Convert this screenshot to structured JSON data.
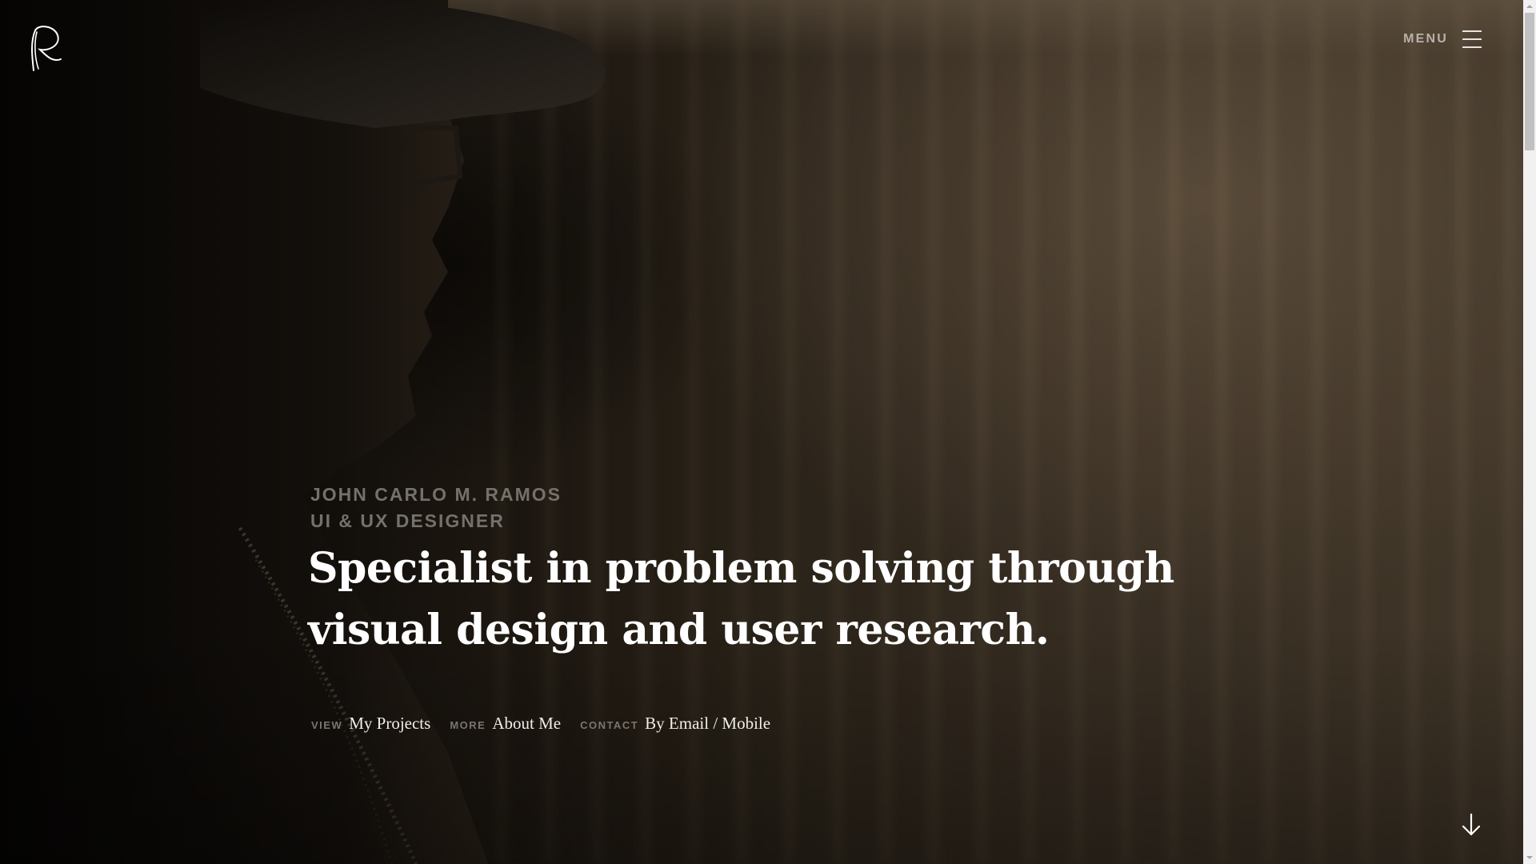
{
  "logo": {
    "icon": "signature-r-logo",
    "color": "#ffffff"
  },
  "header": {
    "menu_label": "MENU",
    "menu_icon": "hamburger-icon"
  },
  "hero": {
    "name": "JOHN CARLO M. RAMOS",
    "role": "UI & UX DESIGNER",
    "headline_line1": "Specialist in problem solving through",
    "headline_line2": "visual design and user research."
  },
  "links": [
    {
      "kicker": "VIEW",
      "text": "My Projects"
    },
    {
      "kicker": "MORE",
      "text": "About Me"
    },
    {
      "kicker": "CONTACT",
      "text": "By Email / Mobile"
    }
  ],
  "scroll_indicator": {
    "icon": "arrow-down-icon"
  },
  "colors": {
    "headline": "#ffffff",
    "muted": "#74706a",
    "background_dark": "#0b0907",
    "background_warm": "#44392b"
  }
}
